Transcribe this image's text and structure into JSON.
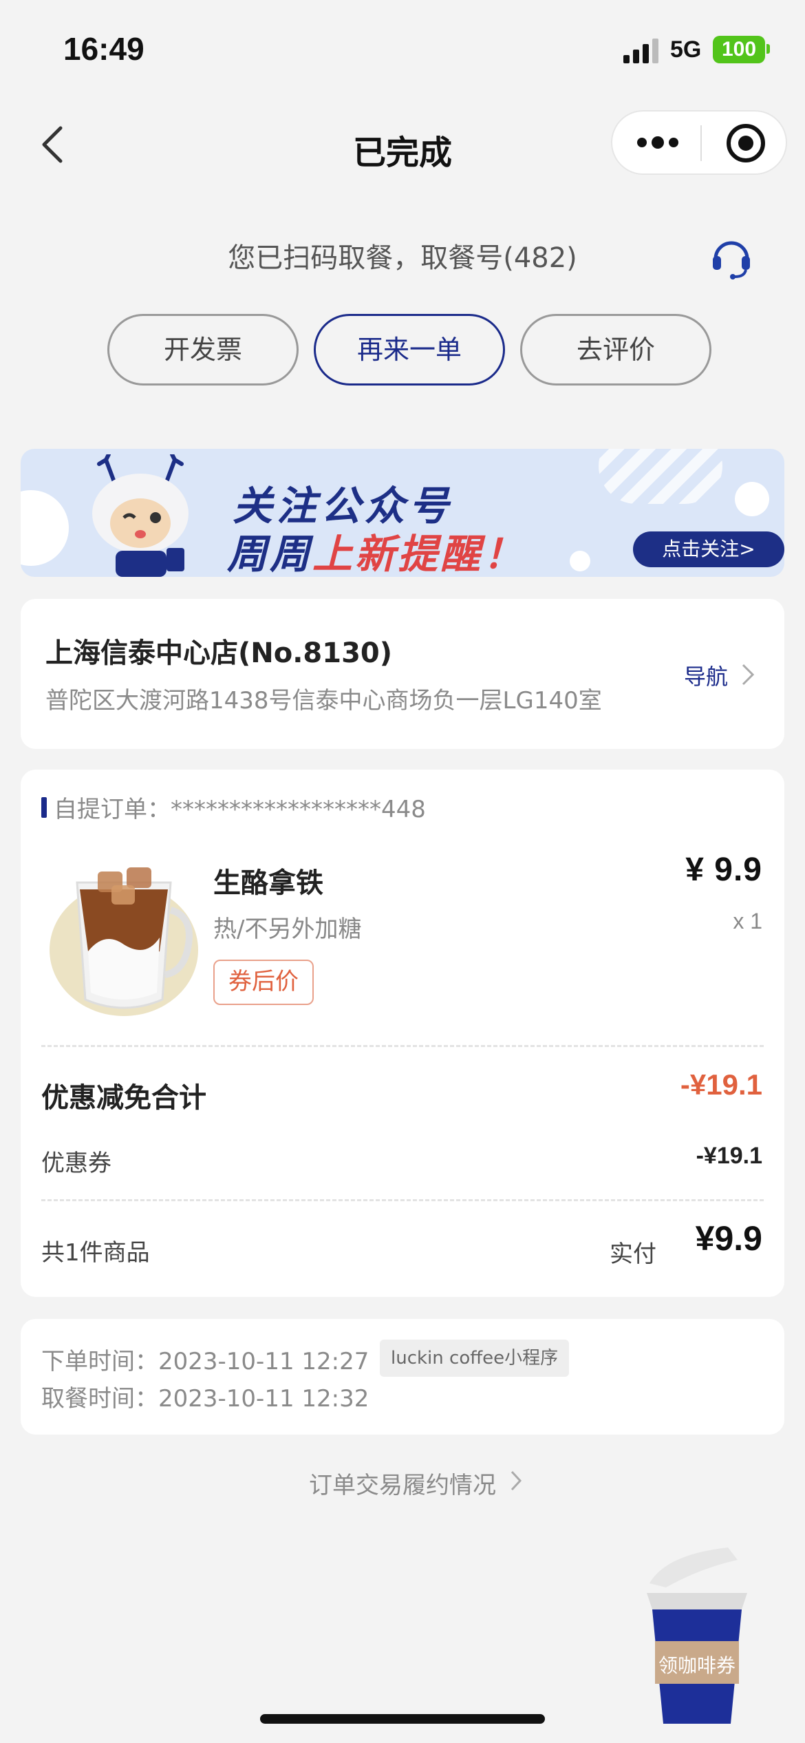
{
  "status_bar": {
    "time": "16:49",
    "network": "5G",
    "battery": "100"
  },
  "nav": {
    "title": "已完成"
  },
  "pickup": {
    "message": "您已扫码取餐，取餐号(482)"
  },
  "actions": {
    "invoice": "开发票",
    "reorder": "再来一单",
    "review": "去评价"
  },
  "banner": {
    "line1": "关注公众号",
    "line2_a": "周周",
    "line2_b": "上新提醒！",
    "follow": "点击关注>"
  },
  "store": {
    "name": "上海信泰中心店(No.8130)",
    "address": "普陀区大渡河路1438号信泰中心商场负一层LG140室",
    "navigate": "导航"
  },
  "order": {
    "label": "自提订单：******************448",
    "item": {
      "name": "生酪拿铁",
      "spec": "热/不另外加糖",
      "tag": "券后价",
      "price": "¥ 9.9",
      "qty": "x 1"
    },
    "discount_total_label": "优惠减免合计",
    "discount_total_value": "-¥19.1",
    "coupon_label": "优惠券",
    "coupon_value": "-¥19.1",
    "items_count": "共1件商品",
    "paid_label": "实付",
    "paid_value": "¥9.9"
  },
  "times": {
    "ordered": "下单时间：2023-10-11 12:27",
    "source": "luckin coffee小程序",
    "picked": "取餐时间：2023-10-11 12:32"
  },
  "fulfilment_link": "订单交易履约情况",
  "coupon_float": {
    "label": "领咖啡券"
  },
  "colors": {
    "brand_blue": "#1a2a8a",
    "discount_orange": "#e0613e",
    "background": "#f3f3f3"
  }
}
